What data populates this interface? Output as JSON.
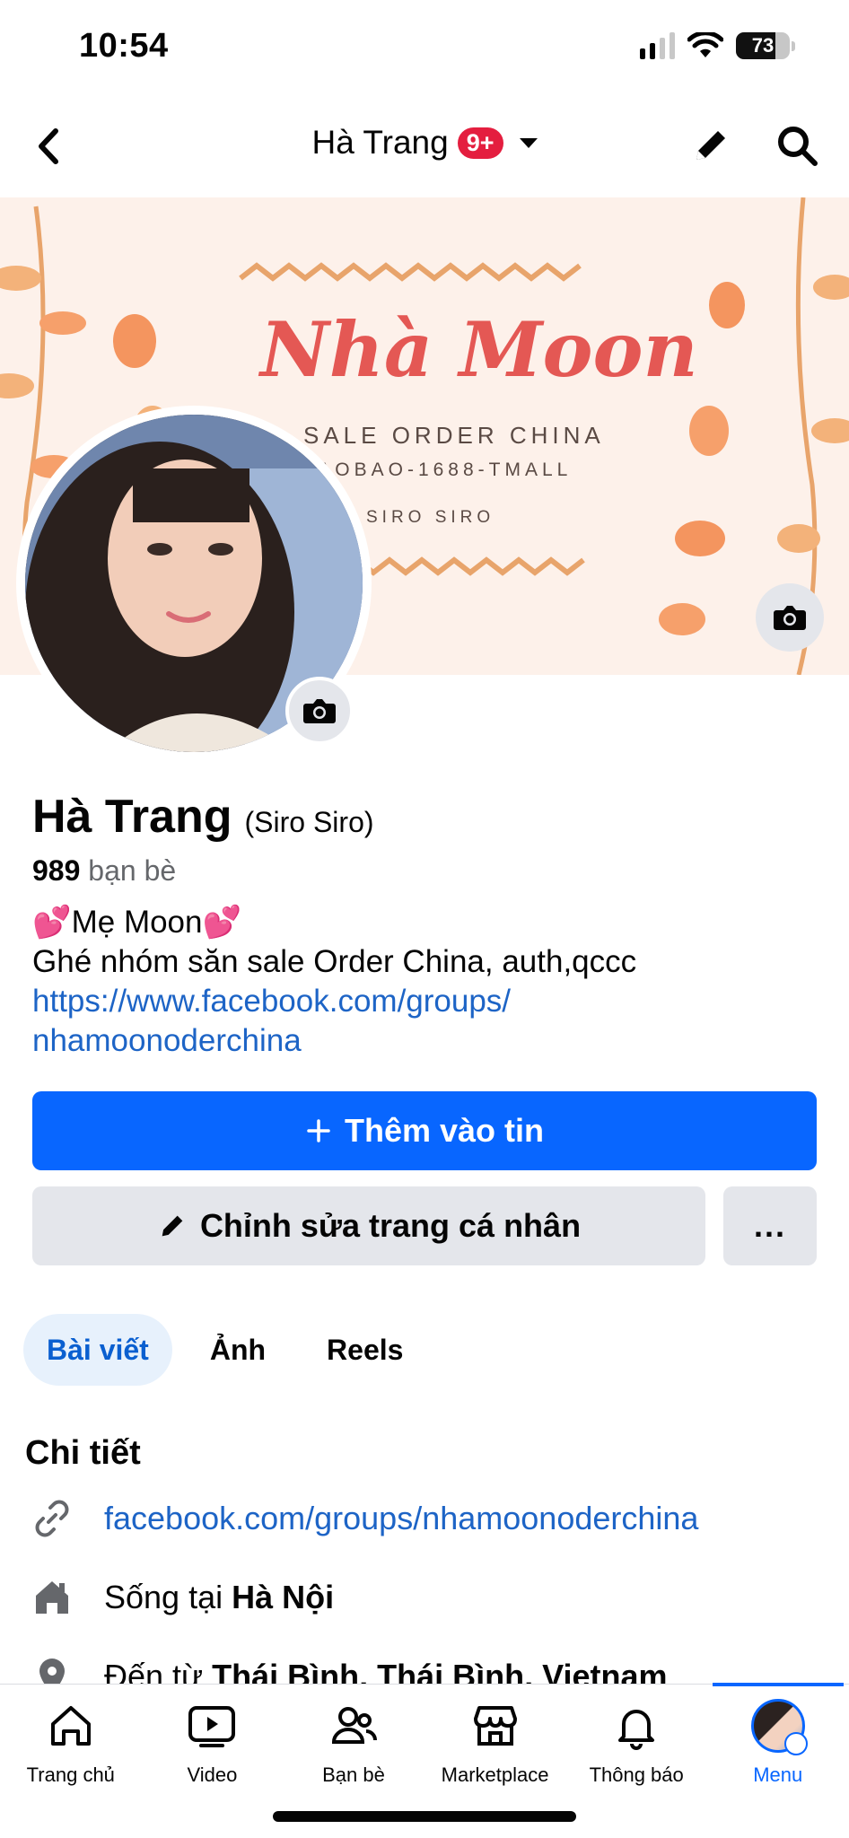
{
  "status_bar": {
    "time": "10:54",
    "battery": "73"
  },
  "nav": {
    "title": "Hà Trang",
    "badge": "9+"
  },
  "cover": {
    "brand": "Nhà Moon",
    "line1": "SALE ORDER CHINA",
    "line2": "TAOBAO-1688-TMALL",
    "line3": "SIRO SIRO"
  },
  "profile": {
    "name": "Hà Trang",
    "alt_name": "(Siro Siro)",
    "friends_count": "989",
    "friends_label": "bạn bè",
    "bio_line1": "Mẹ Moon",
    "bio_line2": "Ghé nhóm săn sale Order China, auth,qccc",
    "bio_link_1": "https://www.facebook.com/groups/",
    "bio_link_2": "nhamoonoderchina"
  },
  "actions": {
    "add_story": "Thêm vào tin",
    "edit_profile": "Chỉnh sửa trang cá nhân",
    "more": "..."
  },
  "tabs": [
    "Bài viết",
    "Ảnh",
    "Reels"
  ],
  "details": {
    "title": "Chi tiết",
    "link": "facebook.com/groups/nhamoonoderchina",
    "lives_prefix": "Sống tại",
    "lives_place": "Hà Nội",
    "from_prefix": "Đến từ",
    "from_place": "Thái Bình, Thái Bình, Vietnam"
  },
  "tabbar": [
    "Trang chủ",
    "Video",
    "Bạn bè",
    "Marketplace",
    "Thông báo",
    "Menu"
  ],
  "colors": {
    "primary": "#0866ff",
    "link": "#1d64c6",
    "badge": "#e41e3f",
    "cover_title": "#e45854"
  }
}
